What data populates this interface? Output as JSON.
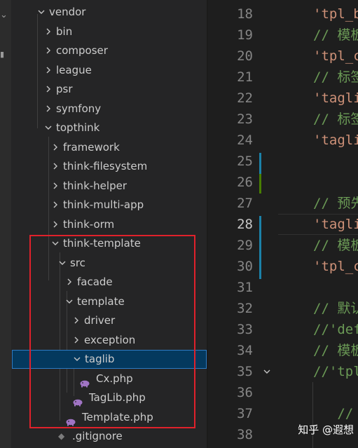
{
  "explorer": {
    "items": [
      {
        "label": "vendor",
        "type": "folder",
        "expanded": true
      },
      {
        "label": "bin",
        "type": "folder",
        "expanded": false
      },
      {
        "label": "composer",
        "type": "folder",
        "expanded": false
      },
      {
        "label": "league",
        "type": "folder",
        "expanded": false
      },
      {
        "label": "psr",
        "type": "folder",
        "expanded": false
      },
      {
        "label": "symfony",
        "type": "folder",
        "expanded": false
      },
      {
        "label": "topthink",
        "type": "folder",
        "expanded": true
      },
      {
        "label": "framework",
        "type": "folder",
        "expanded": false
      },
      {
        "label": "think-filesystem",
        "type": "folder",
        "expanded": false
      },
      {
        "label": "think-helper",
        "type": "folder",
        "expanded": false
      },
      {
        "label": "think-multi-app",
        "type": "folder",
        "expanded": false
      },
      {
        "label": "think-orm",
        "type": "folder",
        "expanded": false
      },
      {
        "label": "think-template",
        "type": "folder",
        "expanded": true
      },
      {
        "label": "src",
        "type": "folder",
        "expanded": true
      },
      {
        "label": "facade",
        "type": "folder",
        "expanded": false
      },
      {
        "label": "template",
        "type": "folder",
        "expanded": true
      },
      {
        "label": "driver",
        "type": "folder",
        "expanded": false
      },
      {
        "label": "exception",
        "type": "folder",
        "expanded": false
      },
      {
        "label": "taglib",
        "type": "folder",
        "expanded": true,
        "selected": true
      },
      {
        "label": "Cx.php",
        "type": "php"
      },
      {
        "label": "TagLib.php",
        "type": "php"
      },
      {
        "label": "Template.php",
        "type": "php"
      },
      {
        "label": ".gitignore",
        "type": "git"
      }
    ]
  },
  "editor": {
    "current_line": 28,
    "lines": [
      {
        "num": "18",
        "code": "'tpl_b",
        "kind": "str"
      },
      {
        "num": "19",
        "code": "// 模板",
        "kind": "cmt"
      },
      {
        "num": "20",
        "code": "'tpl_c",
        "kind": "str"
      },
      {
        "num": "21",
        "code": "// 标签",
        "kind": "cmt"
      },
      {
        "num": "22",
        "code": "'tagli",
        "kind": "str"
      },
      {
        "num": "23",
        "code": "// 标签",
        "kind": "cmt"
      },
      {
        "num": "24",
        "code": "'tagli",
        "kind": "str"
      },
      {
        "num": "25",
        "code": "",
        "kind": "str"
      },
      {
        "num": "26",
        "code": "",
        "kind": "str"
      },
      {
        "num": "27",
        "code": "// 预先",
        "kind": "cmt"
      },
      {
        "num": "28",
        "code": "'tagli",
        "kind": "str"
      },
      {
        "num": "29",
        "code": "// 模板",
        "kind": "cmt"
      },
      {
        "num": "30",
        "code": "'tpl_c",
        "kind": "str"
      },
      {
        "num": "31",
        "code": "",
        "kind": "str"
      },
      {
        "num": "32",
        "code": "// 默认",
        "kind": "cmt"
      },
      {
        "num": "33",
        "code": "//'def",
        "kind": "cmt"
      },
      {
        "num": "34",
        "code": "// 模板",
        "kind": "cmt"
      },
      {
        "num": "35",
        "code": "//'tpl",
        "kind": "cmt"
      },
      {
        "num": "36",
        "code": "",
        "kind": "str"
      },
      {
        "num": "37",
        "code": "   //",
        "kind": "cmt"
      },
      {
        "num": "38",
        "code": "",
        "kind": "str"
      }
    ]
  },
  "watermark": {
    "text": "知乎 @遐想"
  },
  "colors": {
    "accent_selection": "#04395e",
    "highlight_border": "#e0212b",
    "string": "#ce9178",
    "comment": "#6a9955",
    "gutter_added": "#487e02",
    "gutter_modified": "#1b81a8",
    "php_icon": "#a074c4"
  }
}
